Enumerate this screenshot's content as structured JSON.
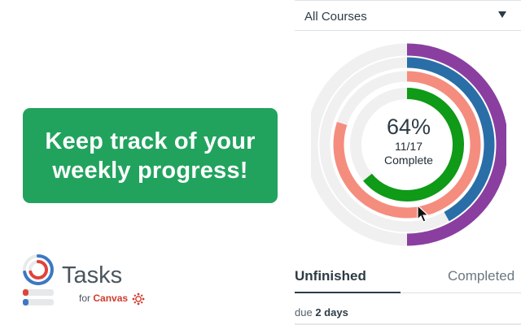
{
  "banner": {
    "line1": "Keep track of your",
    "line2": "weekly progress!",
    "color": "#21a35e"
  },
  "logo": {
    "title": "Tasks",
    "for_text": "for",
    "canvas_text": "Canvas",
    "icon": "tasks-logo-icon",
    "canvas_icon": "canvas-logo-icon"
  },
  "course_select": {
    "value": "All Courses",
    "icon": "chevron-down-icon"
  },
  "progress": {
    "percent_label": "64%",
    "fraction_label": "11/17",
    "complete_label": "Complete",
    "rings": [
      {
        "name": "outer-purple",
        "color": "#8a3fa0",
        "fraction": 0.5
      },
      {
        "name": "blue",
        "color": "#2a6ea8",
        "fraction": 0.42
      },
      {
        "name": "salmon",
        "color": "#f58d7f",
        "fraction": 0.8
      },
      {
        "name": "inner-green",
        "color": "#0f9a17",
        "fraction": 0.64
      }
    ],
    "track_color": "#f0f0f0"
  },
  "tabs": {
    "unfinished": "Unfinished",
    "completed": "Completed"
  },
  "due": {
    "prefix": "due",
    "value": "2 days"
  }
}
